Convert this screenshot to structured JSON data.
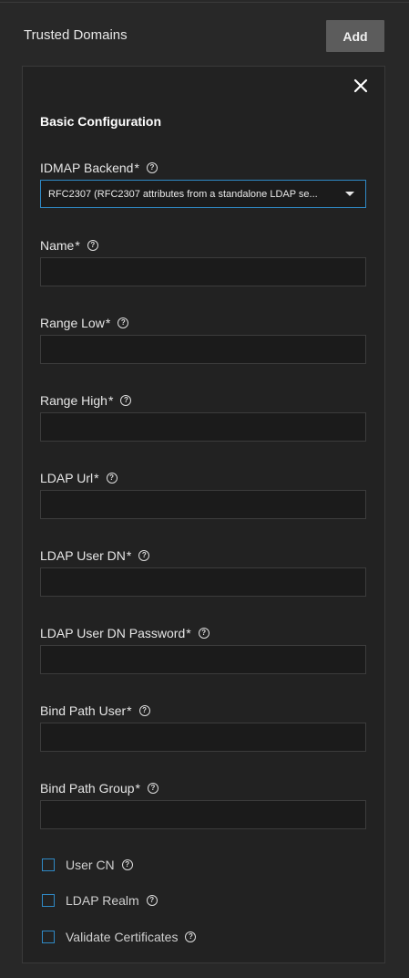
{
  "header": {
    "title": "Trusted Domains",
    "add_label": "Add"
  },
  "form": {
    "section_title": "Basic Configuration",
    "idmap": {
      "label": "IDMAP Backend",
      "required": "*",
      "value": "RFC2307 (RFC2307 attributes from a standalone LDAP se..."
    },
    "fields": [
      {
        "label": "Name",
        "required": "*",
        "value": ""
      },
      {
        "label": "Range Low",
        "required": "*",
        "value": ""
      },
      {
        "label": "Range High",
        "required": "*",
        "value": ""
      },
      {
        "label": "LDAP Url",
        "required": "*",
        "value": ""
      },
      {
        "label": "LDAP User DN",
        "required": "*",
        "value": ""
      },
      {
        "label": "LDAP User DN Password",
        "required": "*",
        "value": ""
      },
      {
        "label": "Bind Path User",
        "required": "*",
        "value": ""
      },
      {
        "label": "Bind Path Group",
        "required": "*",
        "value": ""
      }
    ],
    "checkboxes": [
      {
        "label": "User CN",
        "checked": false
      },
      {
        "label": "LDAP Realm",
        "checked": false
      },
      {
        "label": "Validate Certificates",
        "checked": false
      }
    ]
  },
  "icons": {
    "close": "close-icon",
    "help": "help-circle-icon",
    "dropdown": "chevron-down-icon"
  },
  "colors": {
    "background": "#282828",
    "panel": "#222222",
    "accent": "#2f89c5",
    "button": "#5c5c5c"
  }
}
